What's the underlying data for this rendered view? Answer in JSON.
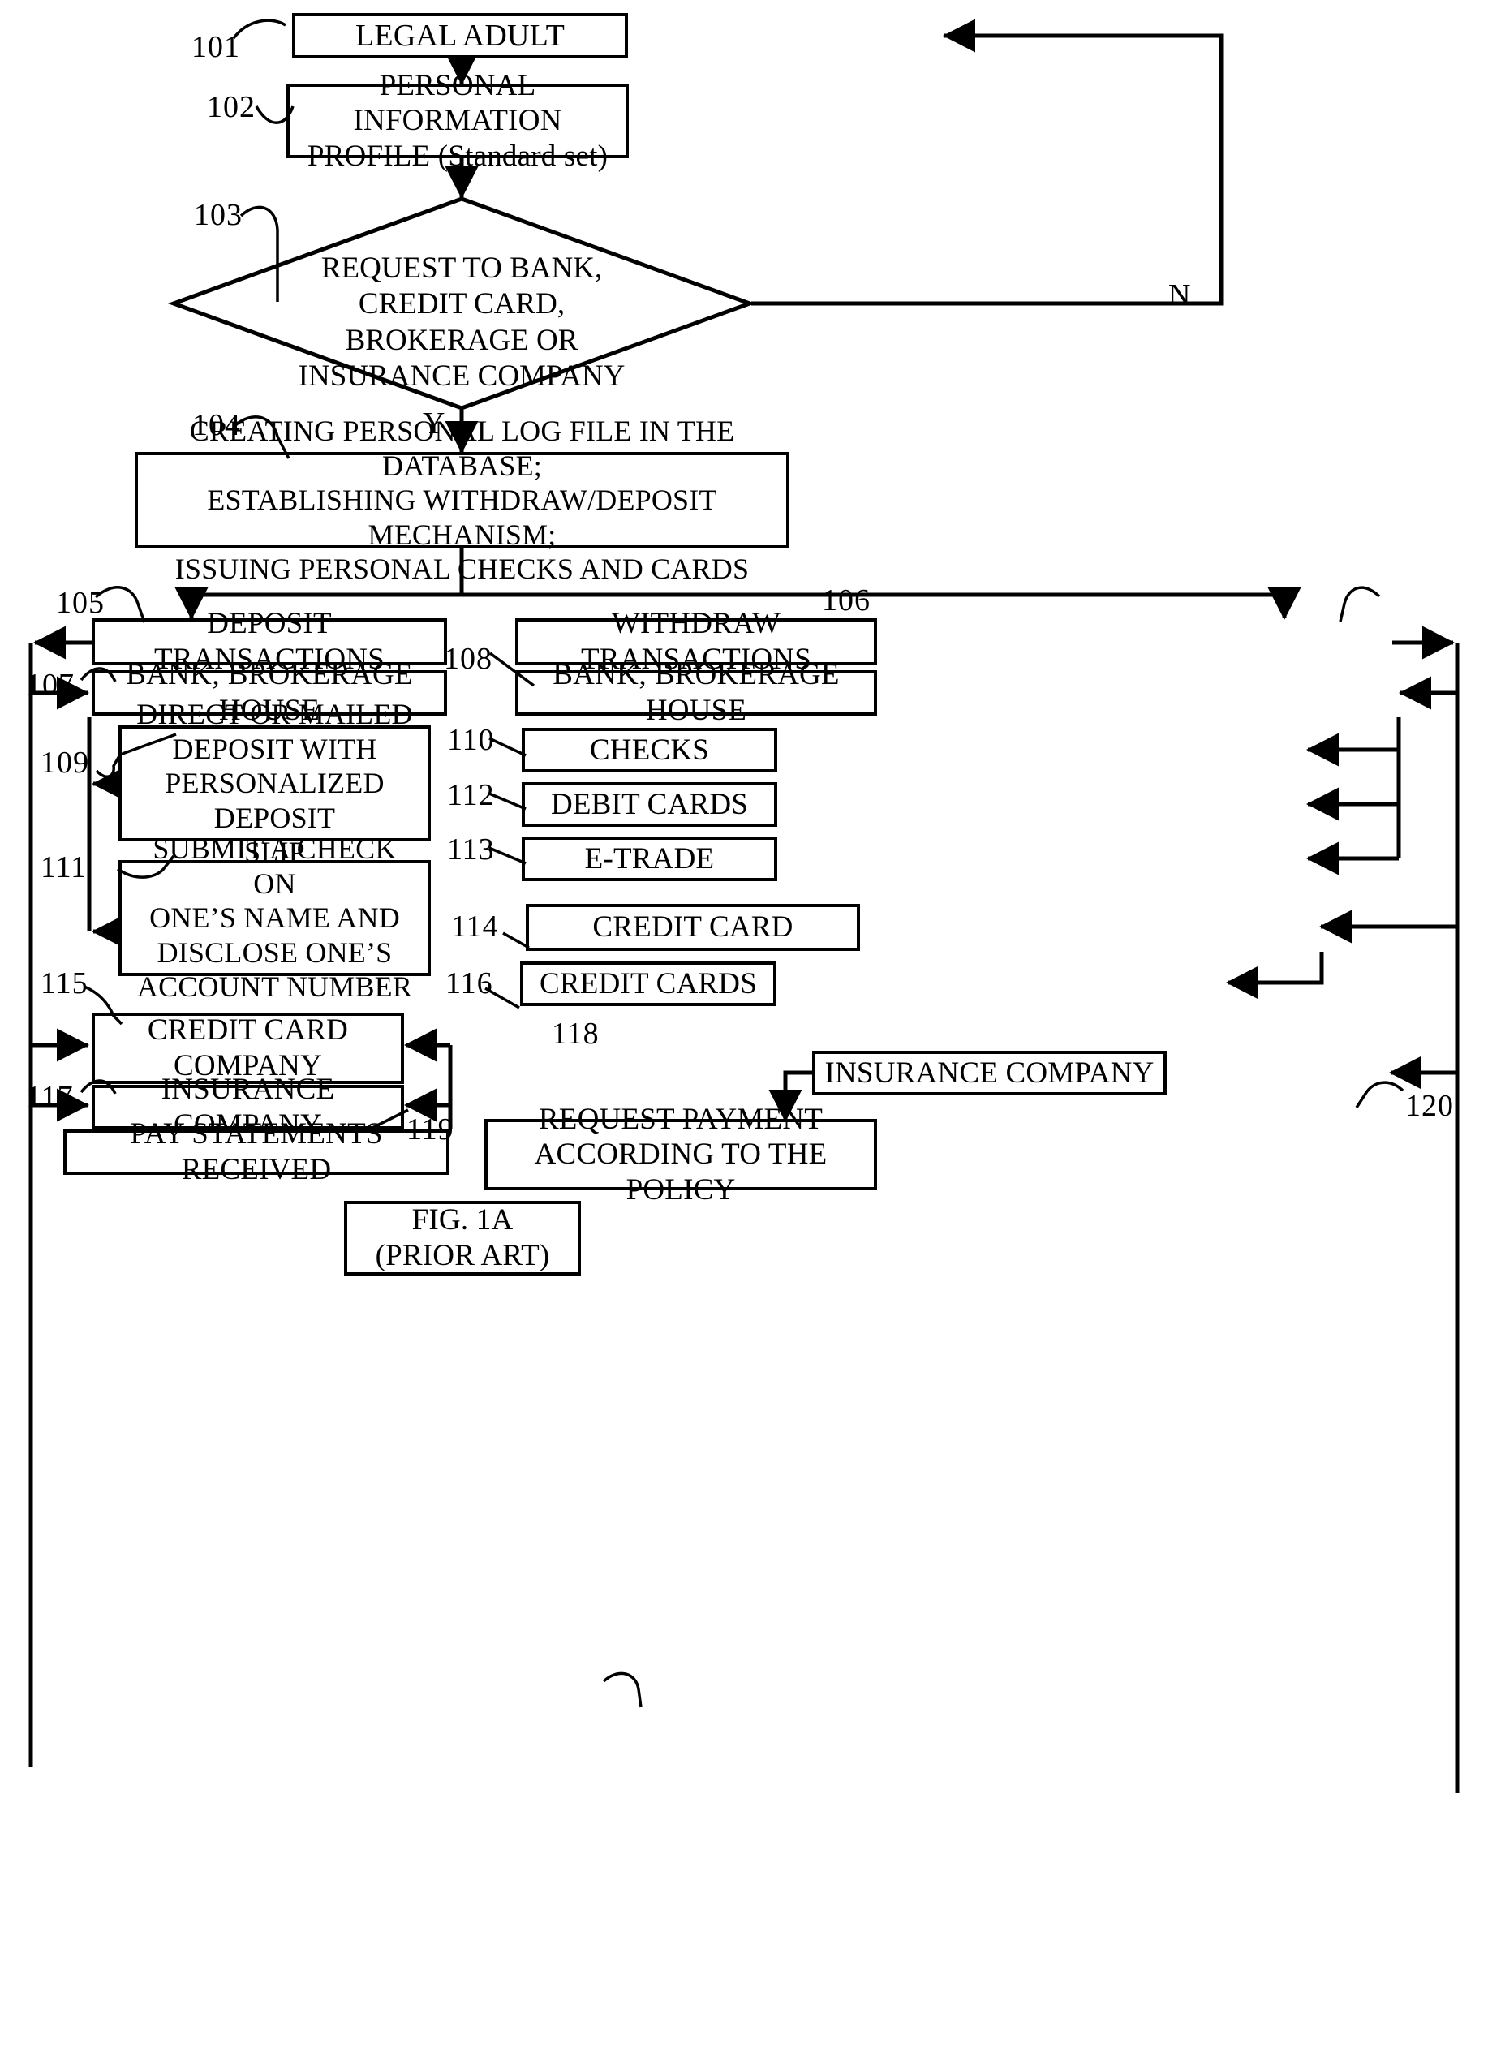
{
  "figure": {
    "caption_line1": "FIG. 1A",
    "caption_line2": "(PRIOR ART)"
  },
  "branches": {
    "no_label": "N",
    "yes_label": "Y"
  },
  "nodes": [
    {
      "id": "101",
      "ref": "101",
      "shape": "rect",
      "lines": [
        "LEGAL ADULT"
      ]
    },
    {
      "id": "102",
      "ref": "102",
      "shape": "rect",
      "lines": [
        "PERSONAL INFORMATION",
        "PROFILE (Standard set)"
      ]
    },
    {
      "id": "103",
      "ref": "103",
      "shape": "diamond",
      "lines": [
        "REQUEST TO BANK,",
        "CREDIT CARD,",
        "BROKERAGE OR",
        "INSURANCE COMPANY"
      ]
    },
    {
      "id": "104",
      "ref": "104",
      "shape": "rect",
      "lines": [
        "CREATING PERSONAL LOG FILE IN THE DATABASE;",
        "ESTABLISHING WITHDRAW/DEPOSIT MECHANISM;",
        "ISSUING PERSONAL CHECKS AND CARDS"
      ]
    },
    {
      "id": "105",
      "ref": "105",
      "shape": "rect",
      "lines": [
        "DEPOSIT TRANSACTIONS"
      ]
    },
    {
      "id": "106",
      "ref": "106",
      "shape": "rect",
      "lines": [
        "WITHDRAW TRANSACTIONS"
      ]
    },
    {
      "id": "107",
      "ref": "107",
      "shape": "rect",
      "lines": [
        "BANK; BROKERAGE HOUSE"
      ]
    },
    {
      "id": "108",
      "ref": "108",
      "shape": "rect",
      "lines": [
        "BANK; BROKERAGE HOUSE"
      ]
    },
    {
      "id": "109",
      "ref": "109",
      "shape": "rect",
      "lines": [
        "DIRECT OR MAILED",
        "DEPOSIT WITH",
        "PERSONALIZED DEPOSIT",
        "SLIP"
      ]
    },
    {
      "id": "110",
      "ref": "110",
      "shape": "rect",
      "lines": [
        "CHECKS"
      ]
    },
    {
      "id": "111",
      "ref": "111",
      "shape": "rect",
      "lines": [
        "SUBMIT A CHECK ON",
        "ONE’S NAME AND",
        "DISCLOSE ONE’S",
        "ACCOUNT NUMBER"
      ]
    },
    {
      "id": "112",
      "ref": "112",
      "shape": "rect",
      "lines": [
        "DEBIT CARDS"
      ]
    },
    {
      "id": "113",
      "ref": "113",
      "shape": "rect",
      "lines": [
        "E-TRADE"
      ]
    },
    {
      "id": "114",
      "ref": "114",
      "shape": "rect",
      "lines": [
        "CREDIT CARD"
      ]
    },
    {
      "id": "115",
      "ref": "115",
      "shape": "rect",
      "lines": [
        "CREDIT CARD",
        "COMPANY"
      ]
    },
    {
      "id": "116",
      "ref": "116",
      "shape": "rect",
      "lines": [
        "CREDIT CARDS"
      ]
    },
    {
      "id": "117",
      "ref": "117",
      "shape": "rect",
      "lines": [
        "INSURANCE COMPANY"
      ]
    },
    {
      "id": "118",
      "ref": "118",
      "shape": "rect",
      "lines": [
        "INSURANCE COMPANY"
      ]
    },
    {
      "id": "119",
      "ref": "119",
      "shape": "rect",
      "lines": [
        "PAY STATEMENTS RECEIVED"
      ]
    },
    {
      "id": "120",
      "ref": "120",
      "shape": "rect",
      "lines": [
        "REQUEST PAYMENT",
        "ACCORDING TO THE POLICY"
      ]
    }
  ]
}
